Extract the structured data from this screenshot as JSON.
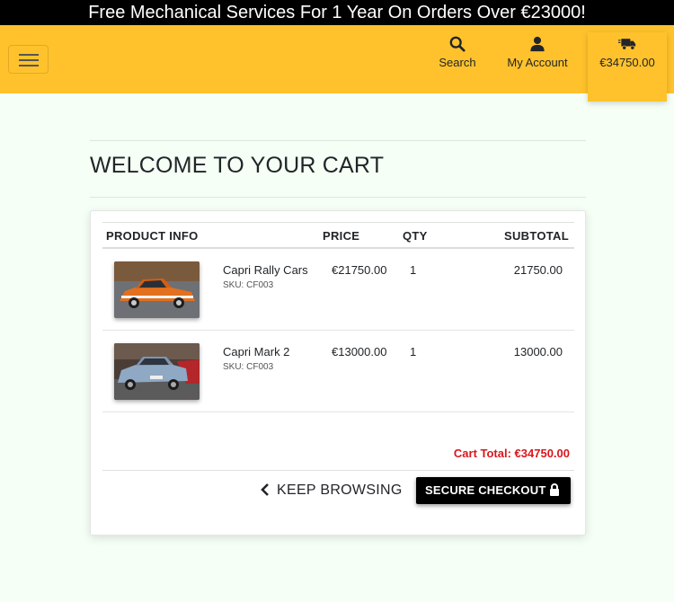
{
  "banner": {
    "text": "Free Mechanical Services For 1 Year On Orders Over €23000!"
  },
  "navbar": {
    "search_label": "Search",
    "account_label": "My Account",
    "cart_total": "€34750.00",
    "icons": {
      "menu": "hamburger-menu-icon",
      "search": "search-icon",
      "account": "user-icon",
      "cart": "shipping-truck-icon"
    },
    "accent_color": "#ffc22c"
  },
  "page": {
    "title": "WELCOME TO YOUR CART"
  },
  "table": {
    "headers": {
      "product": "PRODUCT INFO",
      "price": "PRICE",
      "qty": "QTY",
      "subtotal": "SUBTOTAL"
    },
    "rows": [
      {
        "name": "Capri Rally Cars",
        "sku": "SKU: CF003",
        "price": "€21750.00",
        "qty": "1",
        "subtotal": "21750.00"
      },
      {
        "name": "Capri Mark 2",
        "sku": "SKU: CF003",
        "price": "€13000.00",
        "qty": "1",
        "subtotal": "13000.00"
      }
    ]
  },
  "summary": {
    "cart_total": "Cart Total: €34750.00",
    "total_color": "#d9161c"
  },
  "actions": {
    "keep_browsing": "KEEP BROWSING",
    "checkout": "SECURE CHECKOUT"
  }
}
